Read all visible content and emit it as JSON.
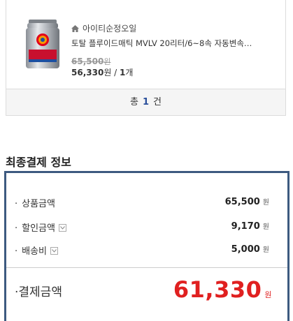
{
  "order": {
    "seller": "아이티순정오일",
    "product_name": "토탈 플루이드매틱 MVLV 20리터/6~8속 자동변속…",
    "original_price": "65,500",
    "original_unit": "원",
    "sale_price": "56,330",
    "sale_unit": "원",
    "separator": " / ",
    "quantity": "1",
    "quantity_unit": "개",
    "thumb_brand": "TOTAL"
  },
  "total_bar": {
    "prefix": "총",
    "count": "1",
    "suffix": "건"
  },
  "payment": {
    "title": "최종결제 정보",
    "bullet": "·",
    "lines": [
      {
        "label": "상품금액",
        "amount": "65,500",
        "unit": "원",
        "expandable": false
      },
      {
        "label": "할인금액",
        "amount": "9,170",
        "unit": "원",
        "expandable": true
      },
      {
        "label": "배송비",
        "amount": "5,000",
        "unit": "원",
        "expandable": true
      }
    ],
    "final_label": "결제금액",
    "final_amount": "61,330",
    "final_unit": "원"
  },
  "colors": {
    "accent_blue": "#2a4f9b",
    "box_border": "#3d5a80",
    "final_red": "#e02020"
  }
}
